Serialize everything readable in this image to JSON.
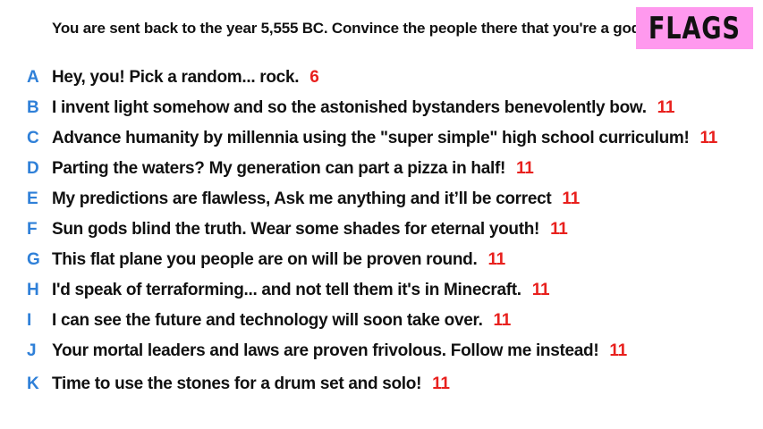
{
  "prompt": "You are sent back to the year 5,555 BC. Convince the people there that you're a god.",
  "badge": {
    "label": "FLAGS",
    "color": "#ff99ee"
  },
  "colors": {
    "letter": "#2f80d8",
    "score": "#e8201d",
    "text": "#111111"
  },
  "answers": [
    {
      "letter": "A",
      "text": "Hey, you! Pick a random... rock.",
      "score": "6"
    },
    {
      "letter": "B",
      "text": "I invent light somehow and so the astonished bystanders benevolently bow.",
      "score": "11"
    },
    {
      "letter": "C",
      "text": "Advance humanity by millennia using the \"super simple\" high school curriculum!",
      "score": "11"
    },
    {
      "letter": "D",
      "text": "Parting the waters? My generation can part a pizza in half!",
      "score": "11"
    },
    {
      "letter": "E",
      "text": "My predictions are flawless, Ask me anything and it’ll be correct",
      "score": "11"
    },
    {
      "letter": "F",
      "text": "Sun gods blind the truth. Wear some shades for eternal youth!",
      "score": "11"
    },
    {
      "letter": "G",
      "text": "This flat plane you people are on will be proven round.",
      "score": "11"
    },
    {
      "letter": "H",
      "text": "I'd speak of terraforming... and not tell them it's in Minecraft.",
      "score": "11"
    },
    {
      "letter": "I",
      "text": "I can see the future and technology will soon take over.",
      "score": "11"
    },
    {
      "letter": "J",
      "text": "Your mortal leaders and laws are proven frivolous. Follow me instead!",
      "score": "11"
    },
    {
      "letter": "K",
      "text": "Time to use the stones for a drum set and solo!",
      "score": "11"
    }
  ]
}
